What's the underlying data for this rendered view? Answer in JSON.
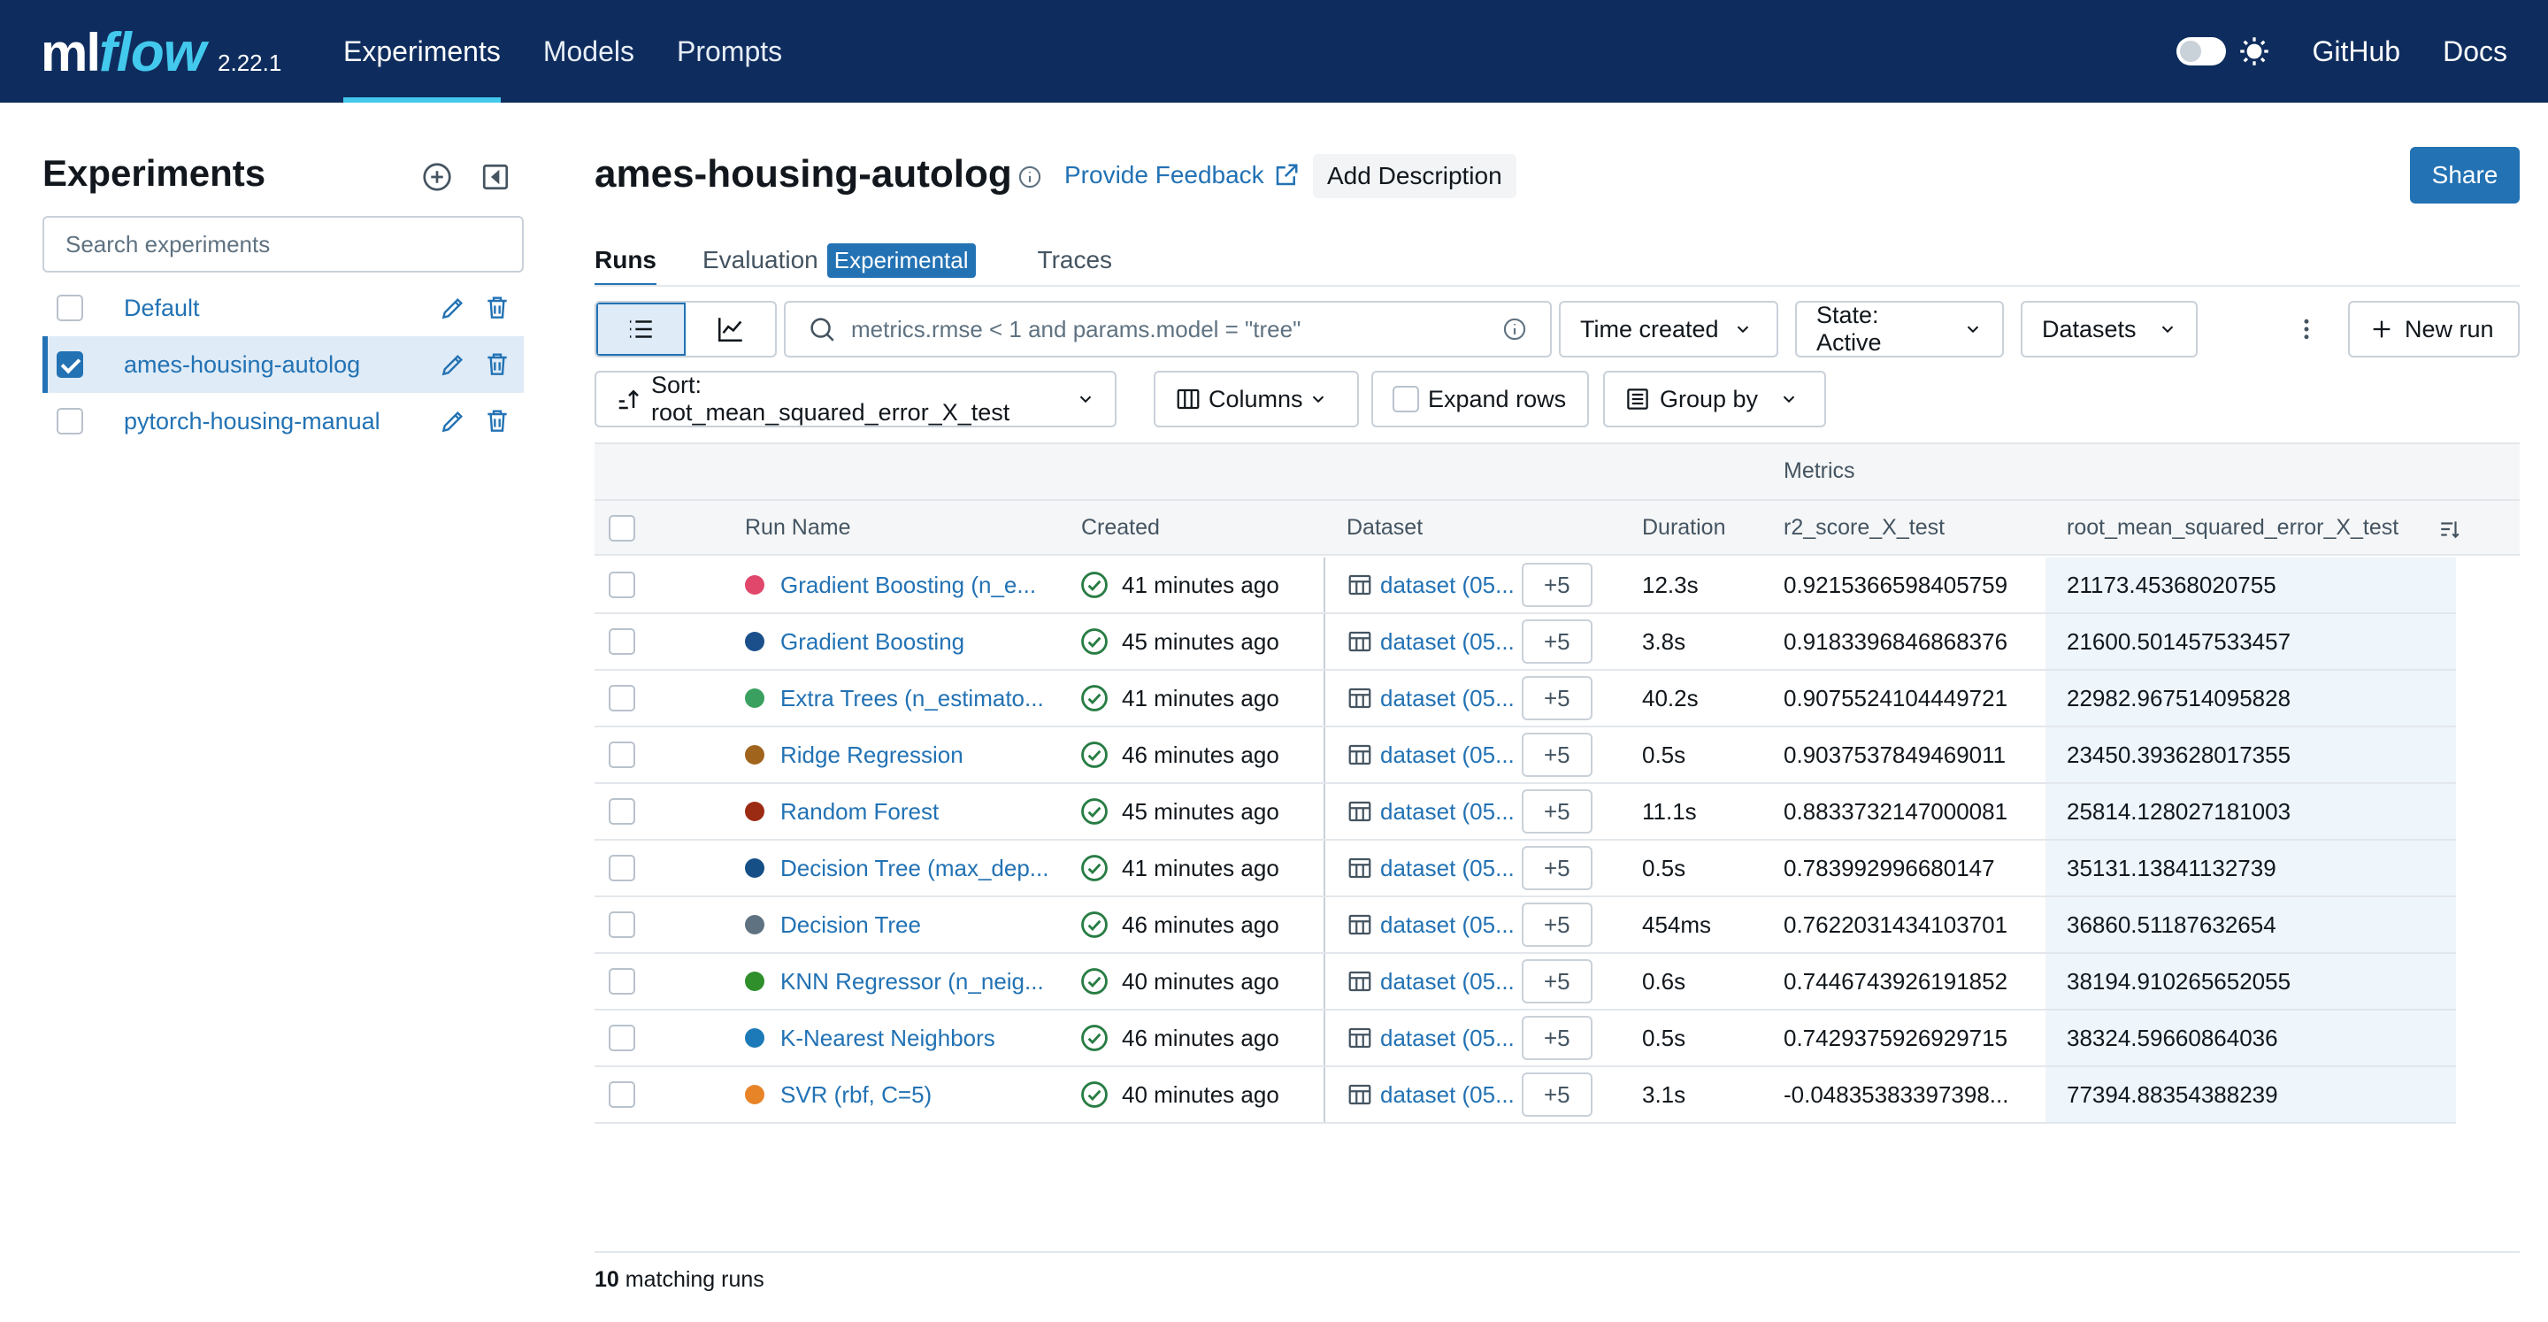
{
  "header": {
    "logo_ml": "ml",
    "logo_flow": "flow",
    "version": "2.22.1",
    "nav": [
      {
        "label": "Experiments",
        "active": true
      },
      {
        "label": "Models",
        "active": false
      },
      {
        "label": "Prompts",
        "active": false
      }
    ],
    "links": [
      "GitHub",
      "Docs"
    ],
    "accent_color": "#43c9ed",
    "bg_color": "#0e2d5e"
  },
  "sidebar": {
    "title": "Experiments",
    "search_placeholder": "Search experiments",
    "experiments": [
      {
        "name": "Default",
        "checked": false
      },
      {
        "name": "ames-housing-autolog",
        "checked": true
      },
      {
        "name": "pytorch-housing-manual",
        "checked": false
      }
    ]
  },
  "main": {
    "title": "ames-housing-autolog",
    "feedback_label": "Provide Feedback",
    "add_description_label": "Add Description",
    "share_label": "Share",
    "tabs": [
      {
        "label": "Runs",
        "active": true
      },
      {
        "label": "Evaluation",
        "tag": "Experimental"
      },
      {
        "label": "Traces"
      }
    ],
    "search_placeholder": "metrics.rmse < 1 and params.model = \"tree\"",
    "filters": {
      "time_created": "Time created",
      "state": "State: Active",
      "datasets": "Datasets",
      "new_run": "New run",
      "sort": "Sort: root_mean_squared_error_X_test",
      "columns": "Columns",
      "expand_rows": "Expand rows",
      "group_by": "Group by"
    },
    "table": {
      "group_header": "Metrics",
      "columns": [
        "Run Name",
        "Created",
        "Dataset",
        "Duration",
        "r2_score_X_test",
        "root_mean_squared_error_X_test"
      ],
      "rows": [
        {
          "name": "Gradient Boosting (n_e...",
          "color": "#e0476b",
          "created": "41 minutes ago",
          "dataset": "dataset (05...",
          "more": "+5",
          "duration": "12.3s",
          "r2": "0.9215366598405759",
          "rmse": "21173.45368020755"
        },
        {
          "name": "Gradient Boosting",
          "color": "#1a4f8b",
          "created": "45 minutes ago",
          "dataset": "dataset (05...",
          "more": "+5",
          "duration": "3.8s",
          "r2": "0.9183396846868376",
          "rmse": "21600.501457533457"
        },
        {
          "name": "Extra Trees (n_estimato...",
          "color": "#3aa05f",
          "created": "41 minutes ago",
          "dataset": "dataset (05...",
          "more": "+5",
          "duration": "40.2s",
          "r2": "0.9075524104449721",
          "rmse": "22982.967514095828"
        },
        {
          "name": "Ridge Regression",
          "color": "#a0641d",
          "created": "46 minutes ago",
          "dataset": "dataset (05...",
          "more": "+5",
          "duration": "0.5s",
          "r2": "0.9037537849469011",
          "rmse": "23450.393628017355"
        },
        {
          "name": "Random Forest",
          "color": "#9c2b14",
          "created": "45 minutes ago",
          "dataset": "dataset (05...",
          "more": "+5",
          "duration": "11.1s",
          "r2": "0.8833732147000081",
          "rmse": "25814.128027181003"
        },
        {
          "name": "Decision Tree (max_dep...",
          "color": "#154f86",
          "created": "41 minutes ago",
          "dataset": "dataset (05...",
          "more": "+5",
          "duration": "0.5s",
          "r2": "0.783992996680147",
          "rmse": "35131.13841132739"
        },
        {
          "name": "Decision Tree",
          "color": "#5f7281",
          "created": "46 minutes ago",
          "dataset": "dataset (05...",
          "more": "+5",
          "duration": "454ms",
          "r2": "0.7622031434103701",
          "rmse": "36860.51187632654"
        },
        {
          "name": "KNN Regressor (n_neig...",
          "color": "#2f8f2a",
          "created": "40 minutes ago",
          "dataset": "dataset (05...",
          "more": "+5",
          "duration": "0.6s",
          "r2": "0.7446743926191852",
          "rmse": "38194.910265652055"
        },
        {
          "name": "K-Nearest Neighbors",
          "color": "#1d7ab8",
          "created": "46 minutes ago",
          "dataset": "dataset (05...",
          "more": "+5",
          "duration": "0.5s",
          "r2": "0.7429375926929715",
          "rmse": "38324.59660864036"
        },
        {
          "name": "SVR (rbf, C=5)",
          "color": "#e88428",
          "created": "40 minutes ago",
          "dataset": "dataset (05...",
          "more": "+5",
          "duration": "3.1s",
          "r2": "-0.04835383397398...",
          "rmse": "77394.88354388239"
        }
      ]
    },
    "footer_count": "10",
    "footer_label": "matching runs"
  }
}
